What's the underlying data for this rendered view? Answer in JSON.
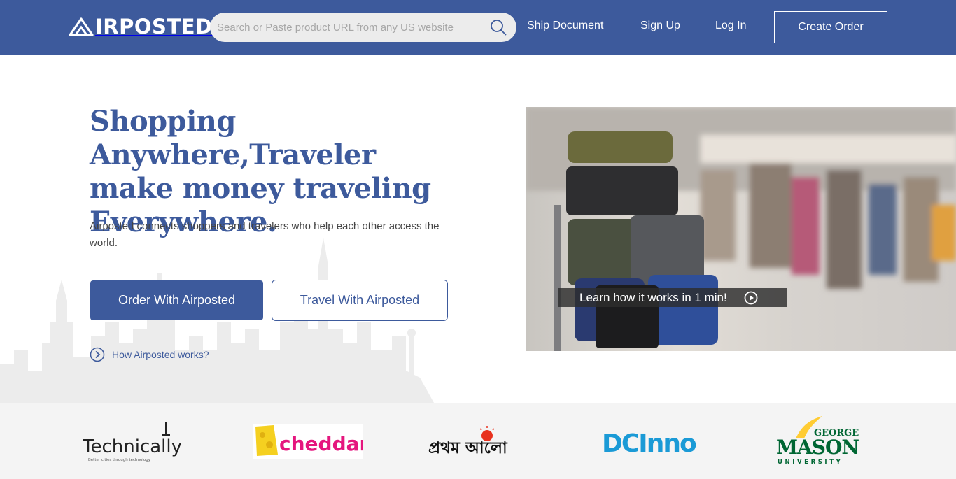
{
  "header": {
    "logo_text": "IRPOSTED",
    "logo_full": "AIRPOSTED",
    "search_placeholder": "Search or Paste product URL from any US website",
    "search_icon": "search-icon",
    "nav": {
      "ship_document": "Ship Document",
      "sign_up": "Sign Up",
      "log_in": "Log In"
    },
    "create_order": "Create Order"
  },
  "hero": {
    "title_lines": [
      "Shopping Anywhere,Traveler",
      "make money traveling",
      "Everywhere."
    ],
    "subtitle": "Airposted connects shoppers and travelers who help each other access the world.",
    "order_button": "Order With Airposted",
    "travel_button": "Travel With Airposted",
    "how_link": "How Airposted works?"
  },
  "video": {
    "caption": "Learn how it works in 1 min!",
    "play_icon": "play-circle-icon"
  },
  "press": {
    "technically": {
      "name": "Technically",
      "tagline": "Better cities through technology"
    },
    "cheddar": {
      "name": "cheddar"
    },
    "prothom_alo": {
      "name": "প্রথম আলো"
    },
    "dcinno": {
      "name": "DCInno"
    },
    "george_mason": {
      "top": "GEORGE",
      "name": "MASON",
      "bottom": "UNIVERSITY"
    }
  },
  "colors": {
    "brand_blue": "#3d5a9c",
    "cheddar_pink": "#e5167e",
    "cheddar_yellow": "#f5d020",
    "dcinno_blue": "#1a9ad6",
    "mason_green": "#006633",
    "mason_gold": "#ffcc33"
  }
}
